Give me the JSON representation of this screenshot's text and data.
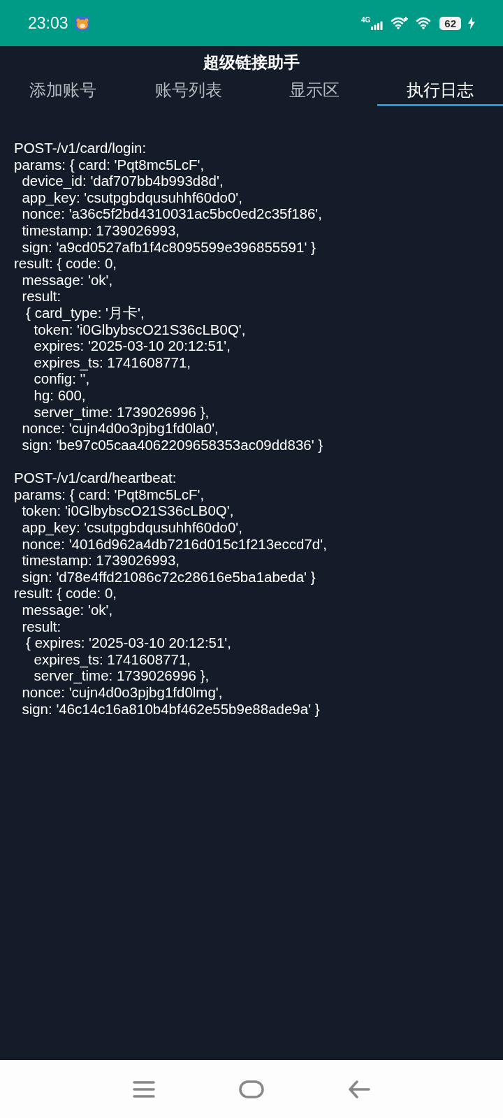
{
  "status_bar": {
    "time": "23:03",
    "network": "4G",
    "battery": "62"
  },
  "app": {
    "title": "超级链接助手"
  },
  "tabs": [
    {
      "label": "添加账号",
      "selected": false
    },
    {
      "label": "账号列表",
      "selected": false
    },
    {
      "label": "显示区",
      "selected": false
    },
    {
      "label": "执行日志",
      "selected": true
    }
  ],
  "log_entries": [
    {
      "lines": [
        "POST-/v1/card/login:",
        "params: { card: 'Pqt8mc5LcF',",
        "  device_id: 'daf707bb4b993d8d',",
        "  app_key: 'csutpgbdqusuhhf60do0',",
        "  nonce: 'a36c5f2bd4310031ac5bc0ed2c35f186',",
        "  timestamp: 1739026993,",
        "  sign: 'a9cd0527afb1f4c8095599e396855591' }",
        "result: { code: 0,",
        "  message: 'ok',",
        "  result:",
        "   { card_type: '月卡',",
        "     token: 'i0GlbybscO21S36cLB0Q',",
        "     expires: '2025-03-10 20:12:51',",
        "     expires_ts: 1741608771,",
        "     config: '',",
        "     hg: 600,",
        "     server_time: 1739026996 },",
        "  nonce: 'cujn4d0o3pjbg1fd0la0',",
        "  sign: 'be97c05caa4062209658353ac09dd836' }"
      ]
    },
    {
      "lines": [
        "POST-/v1/card/heartbeat:",
        "params: { card: 'Pqt8mc5LcF',",
        "  token: 'i0GlbybscO21S36cLB0Q',",
        "  app_key: 'csutpgbdqusuhhf60do0',",
        "  nonce: '4016d962a4db7216d015c1f213eccd7d',",
        "  timestamp: 1739026993,",
        "  sign: 'd78e4ffd21086c72c28616e5ba1abeda' }",
        "result: { code: 0,",
        "  message: 'ok',",
        "  result:",
        "   { expires: '2025-03-10 20:12:51',",
        "     expires_ts: 1741608771,",
        "     server_time: 1739026996 },",
        "  nonce: 'cujn4d0o3pjbg1fd0lmg',",
        "  sign: '46c14c16a810b4bf462e55b9e88ade9a' }"
      ]
    }
  ]
}
